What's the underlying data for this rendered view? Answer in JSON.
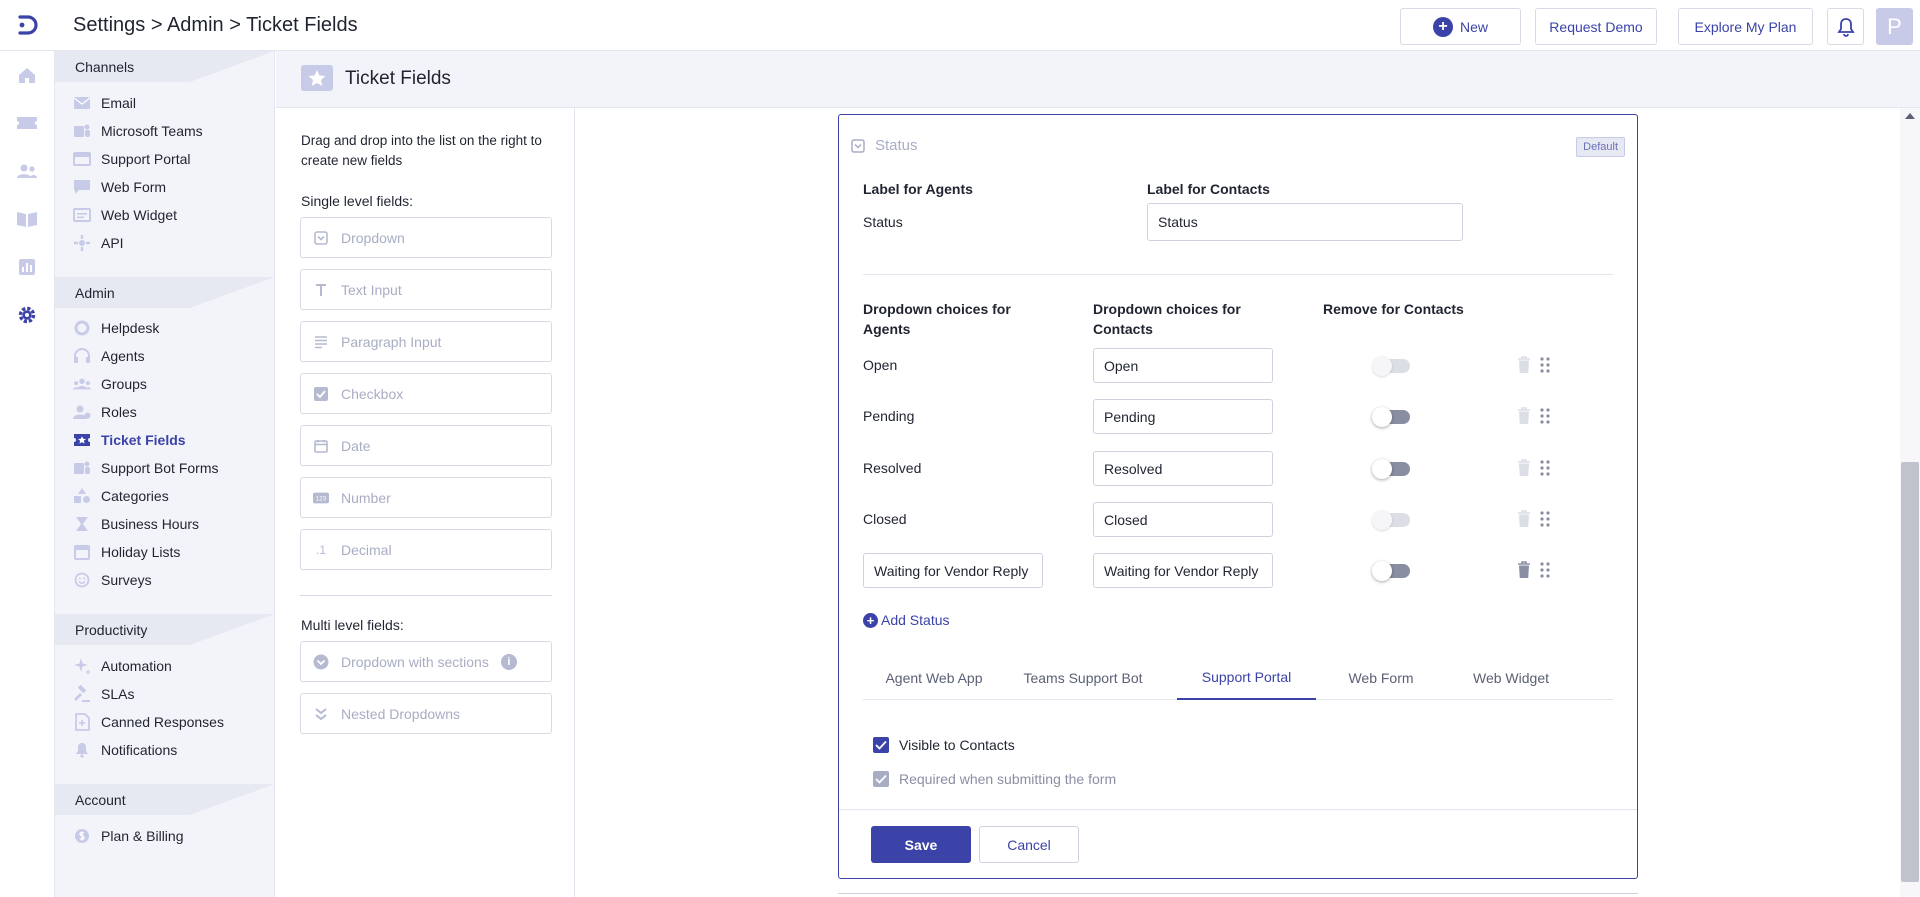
{
  "header": {
    "breadcrumb": "Settings > Admin > Ticket Fields",
    "new_label": "New",
    "request_demo_label": "Request Demo",
    "explore_plan_label": "Explore My Plan",
    "avatar_initial": "P"
  },
  "sidebar": {
    "sections": [
      {
        "title": "Channels",
        "items": [
          "Email",
          "Microsoft Teams",
          "Support Portal",
          "Web Form",
          "Web Widget",
          "API"
        ]
      },
      {
        "title": "Admin",
        "items": [
          "Helpdesk",
          "Agents",
          "Groups",
          "Roles",
          "Ticket Fields",
          "Support Bot Forms",
          "Categories",
          "Business Hours",
          "Holiday Lists",
          "Surveys"
        ]
      },
      {
        "title": "Productivity",
        "items": [
          "Automation",
          "SLAs",
          "Canned Responses",
          "Notifications"
        ]
      },
      {
        "title": "Account",
        "items": [
          "Plan & Billing"
        ]
      }
    ],
    "active_item": "Ticket Fields"
  },
  "content_header": {
    "title": "Ticket Fields"
  },
  "palette": {
    "hint": "Drag and drop into the list on the right to create new fields",
    "single_label": "Single level fields:",
    "single_fields": [
      "Dropdown",
      "Text Input",
      "Paragraph Input",
      "Checkbox",
      "Date",
      "Number",
      "Decimal"
    ],
    "multi_label": "Multi level fields:",
    "multi_fields": [
      "Dropdown with sections",
      "Nested Dropdowns"
    ]
  },
  "editor": {
    "field_name": "Status",
    "badge": "Default",
    "label_agents_heading": "Label for Agents",
    "label_agents_value": "Status",
    "label_contacts_heading": "Label for Contacts",
    "label_contacts_value": "Status",
    "choices_agents_heading": "Dropdown choices for Agents",
    "choices_contacts_heading": "Dropdown choices for Contacts",
    "remove_heading": "Remove for Contacts",
    "choices": [
      {
        "agent": "Open",
        "contact": "Open",
        "editable": false,
        "toggle_enabled": false
      },
      {
        "agent": "Pending",
        "contact": "Pending",
        "editable": false,
        "toggle_enabled": true
      },
      {
        "agent": "Resolved",
        "contact": "Resolved",
        "editable": false,
        "toggle_enabled": true
      },
      {
        "agent": "Closed",
        "contact": "Closed",
        "editable": false,
        "toggle_enabled": false
      },
      {
        "agent": "Waiting for Vendor Reply",
        "contact": "Waiting for Vendor Reply",
        "editable": true,
        "toggle_enabled": true
      }
    ],
    "add_status_label": "Add Status",
    "tabs": [
      "Agent Web App",
      "Teams Support Bot",
      "Support Portal",
      "Web Form",
      "Web Widget"
    ],
    "active_tab": "Support Portal",
    "visible_to_contacts": "Visible to Contacts",
    "required_on_submit": "Required when submitting the form",
    "save_label": "Save",
    "cancel_label": "Cancel"
  },
  "colors": {
    "accent": "#3b43a8",
    "sidebar_bg": "#f3f4f9",
    "muted": "#a9adc4"
  }
}
